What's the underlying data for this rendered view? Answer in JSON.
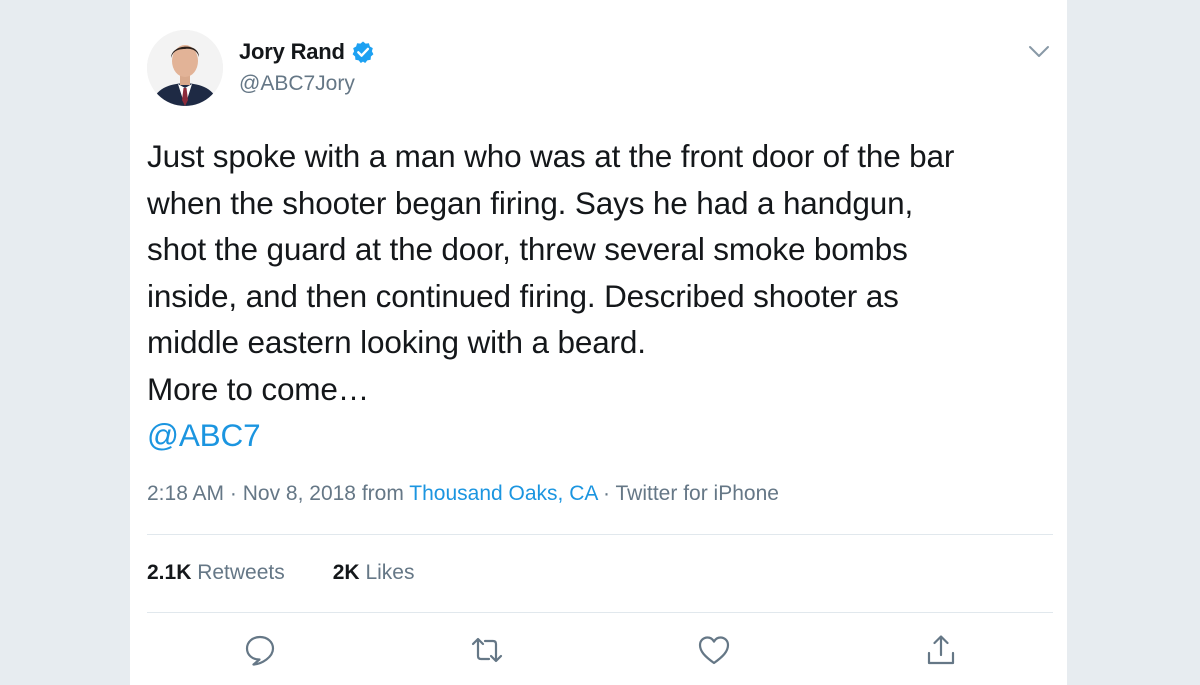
{
  "author": {
    "display_name": "Jory Rand",
    "handle": "@ABC7Jory",
    "verified": true,
    "avatar": "profile-photo"
  },
  "tweet": {
    "lines": [
      "Just spoke with a man who was at the front door of the bar",
      "when the shooter began firing. Says he had a handgun,",
      "shot the guard at the door, threw several smoke bombs",
      "inside, and then continued firing. Described shooter as",
      "middle eastern looking with a beard.",
      "More to come…"
    ],
    "mention": "@ABC7"
  },
  "meta": {
    "time": "2:18 AM",
    "sep1": " · ",
    "date": "Nov 8, 2018",
    "from": " from ",
    "location": "Thousand Oaks, CA",
    "sep2": " · ",
    "client": "Twitter for iPhone"
  },
  "stats": {
    "retweets_count": "2.1K",
    "retweets_label": "Retweets",
    "likes_count": "2K",
    "likes_label": "Likes"
  },
  "colors": {
    "background": "#e7ecf0",
    "card": "#ffffff",
    "text": "#14171a",
    "secondary": "#657786",
    "link": "#1b95e0",
    "divider": "#e1e8ed",
    "verified": "#1da1f2"
  },
  "icons": {
    "menu": "chevron-down-icon",
    "reply": "reply-icon",
    "retweet": "retweet-icon",
    "like": "heart-icon",
    "share": "share-icon"
  }
}
